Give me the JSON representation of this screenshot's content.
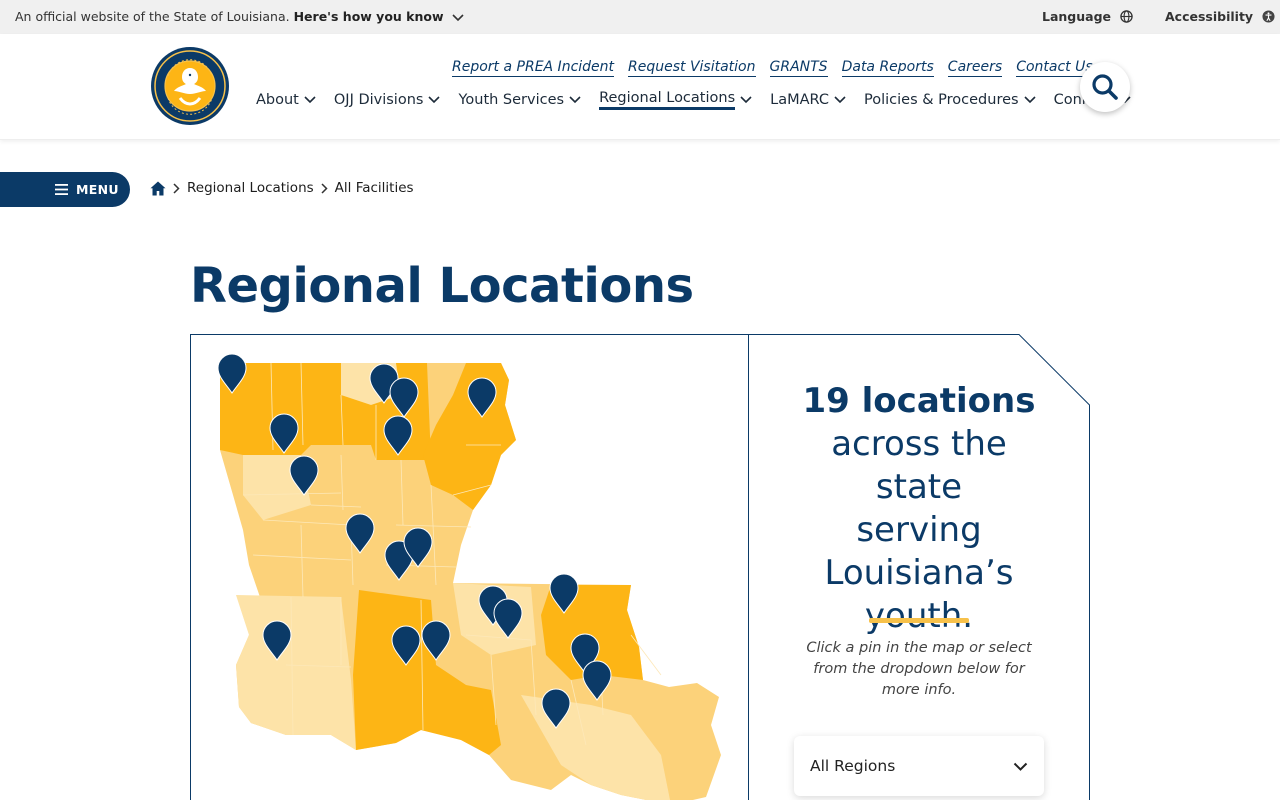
{
  "banner": {
    "official_text": "An official website of the State of Louisiana.",
    "how_you_know": "Here's how you know",
    "language": "Language",
    "accessibility": "Accessibility"
  },
  "header": {
    "logo_alt": "State of Louisiana Office of Juvenile Justice seal",
    "utility_links": [
      "Report a PREA Incident",
      "Request Visitation",
      "GRANTS",
      "Data Reports",
      "Careers",
      "Contact Us"
    ],
    "nav": [
      {
        "label": "About",
        "active": false
      },
      {
        "label": "OJJ Divisions",
        "active": false
      },
      {
        "label": "Youth Services",
        "active": false
      },
      {
        "label": "Regional Locations",
        "active": true
      },
      {
        "label": "LaMARC",
        "active": false
      },
      {
        "label": "Policies & Procedures",
        "active": false
      },
      {
        "label": "Connect",
        "active": false
      }
    ]
  },
  "menu_button": "MENU",
  "breadcrumb": [
    "Regional Locations",
    "All Facilities"
  ],
  "page_title": "Regional Locations",
  "info": {
    "count": "19 locations",
    "rest": "across the state serving Louisiana’s youth.",
    "hint": "Click a pin in the map or select from the dropdown below for more info.",
    "dropdown_value": "All Regions"
  },
  "map": {
    "pin_count": 19,
    "pin_color": "#0b3a67",
    "region_colors": [
      "#fdb515",
      "#fcd27a",
      "#fde3a8"
    ]
  },
  "colors": {
    "brand": "#0b3a67",
    "accent": "#f7c14a"
  }
}
